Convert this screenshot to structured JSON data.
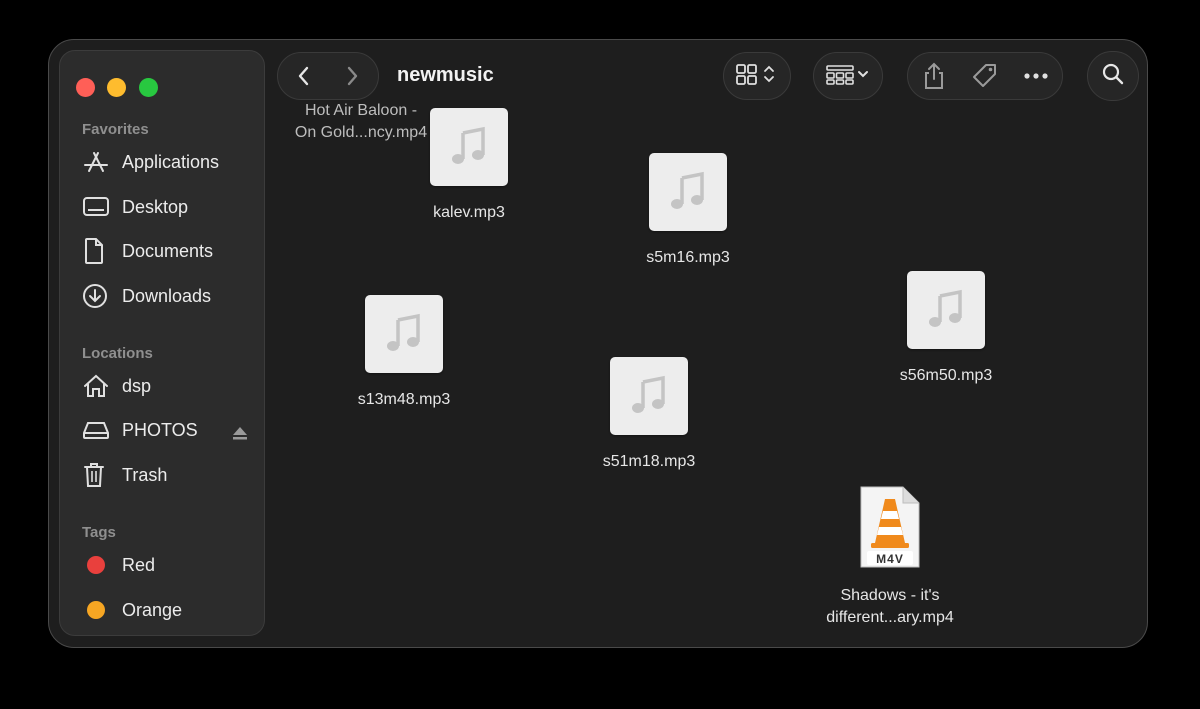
{
  "window": {
    "title": "newmusic",
    "traffic_colors": {
      "close": "#ff5f57",
      "minimize": "#febc2e",
      "zoom": "#28c840"
    }
  },
  "sidebar": {
    "favorites_title": "Favorites",
    "favorites": [
      {
        "label": "Applications",
        "icon": "applications-icon"
      },
      {
        "label": "Desktop",
        "icon": "desktop-icon"
      },
      {
        "label": "Documents",
        "icon": "document-icon"
      },
      {
        "label": "Downloads",
        "icon": "download-icon"
      }
    ],
    "locations_title": "Locations",
    "locations": [
      {
        "label": "dsp",
        "icon": "home-icon"
      },
      {
        "label": "PHOTOS",
        "icon": "drive-icon"
      },
      {
        "label": "Trash",
        "icon": "trash-icon"
      }
    ],
    "tags_title": "Tags",
    "tags": [
      {
        "label": "Red",
        "color": "#e9403d"
      },
      {
        "label": "Orange",
        "color": "#f6a623"
      }
    ]
  },
  "files": [
    {
      "name": "kalev.mp3",
      "type": "audio"
    },
    {
      "name": "s5m16.mp3",
      "type": "audio"
    },
    {
      "name": "s13m48.mp3",
      "type": "audio"
    },
    {
      "name": "s51m18.mp3",
      "type": "audio"
    },
    {
      "name": "s56m50.mp3",
      "type": "audio"
    },
    {
      "name_line1": "Shadows - it's",
      "name_line2": "different...ary.mp4",
      "type": "video",
      "badge": "M4V"
    }
  ],
  "dragging_file": {
    "line1": "Hot Air Baloon -",
    "line2": "On Gold...ncy.mp4"
  }
}
